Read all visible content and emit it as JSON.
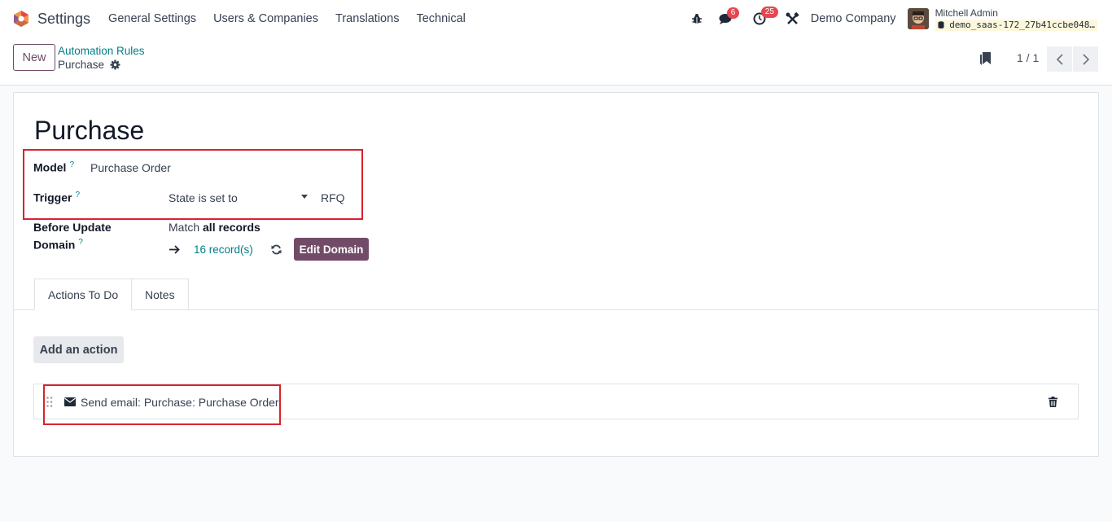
{
  "navbar": {
    "app_name": "Settings",
    "menu": [
      "General Settings",
      "Users & Companies",
      "Translations",
      "Technical"
    ],
    "messages_count": "6",
    "activities_count": "25",
    "company": "Demo Company",
    "user_name": "Mitchell Admin",
    "database": "demo_saas-172_27b41ccbe048…"
  },
  "control_panel": {
    "new_label": "New",
    "breadcrumb_parent": "Automation Rules",
    "breadcrumb_current": "Purchase",
    "pager_value": "1 / 1"
  },
  "form": {
    "title": "Purchase",
    "model_label": "Model",
    "model_value": "Purchase Order",
    "trigger_label": "Trigger",
    "trigger_value": "State is set to",
    "trigger_state": "RFQ",
    "domain_label_line1": "Before Update",
    "domain_label_line2": "Domain",
    "domain_match_prefix": "Match",
    "domain_match_value": "all records",
    "records_count": "16 record(s)",
    "edit_domain_label": "Edit Domain",
    "help_marker": "?"
  },
  "tabs": {
    "actions": "Actions To Do",
    "notes": "Notes"
  },
  "actions": {
    "add_label": "Add an action",
    "items": [
      {
        "label": "Send email: Purchase: Purchase Order"
      }
    ]
  },
  "colors": {
    "primary": "#714b67",
    "link": "#017e84",
    "highlight": "#d9232d",
    "badge": "#e8464e"
  }
}
